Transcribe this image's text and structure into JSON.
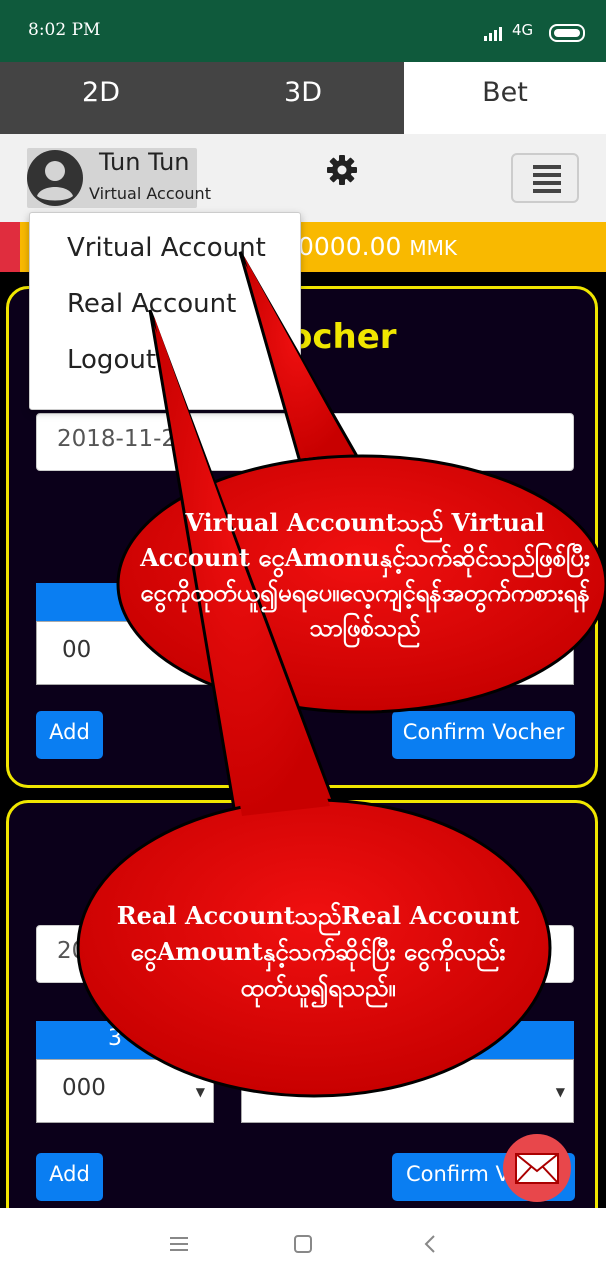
{
  "status_bar": {
    "time": "8:02 PM",
    "network": "4G"
  },
  "tabs": [
    {
      "label": "2D",
      "active": false
    },
    {
      "label": "3D",
      "active": false
    },
    {
      "label": "Bet",
      "active": true
    }
  ],
  "header": {
    "user_name": "Tun Tun",
    "account_type": "Virtual Account",
    "icons": [
      "user-avatar-icon",
      "gear-icon",
      "hamburger-menu-icon"
    ]
  },
  "balance": {
    "amount": "0000.00",
    "currency": "MMK"
  },
  "dropdown": {
    "items": [
      "Vritual Account",
      "Real Account",
      "Logout"
    ]
  },
  "panel1": {
    "title": "ocher",
    "date": "2018-11-2",
    "number_value": "00",
    "add_label": "Add",
    "confirm_label": "Confirm Vocher"
  },
  "panel2": {
    "date": "20",
    "column_label": "3",
    "number_value": "000",
    "add_label": "Add",
    "confirm_label": "Confirm V"
  },
  "callouts": [
    {
      "text": "Virtual Accountသည် Virtual Account ငွေAmonuနှင့်သက်ဆိုင်သည်ဖြစ်ပြီး ငွေကိုထုတ်ယူ၍မရပေ။လေ့ကျင့်ရန်အတွက်ကစားရန်သာဖြစ်သည်"
    },
    {
      "text": "Real Accountသည်Real Account ငွေAmountနှင့်သက်ဆိုင်ပြီး ငွေကိုလည်းထုတ်ယူ၍ရသည်။"
    }
  ],
  "colors": {
    "status_bar": "#0f5a3c",
    "tab_bar": "#444444",
    "accent_blue": "#0a7ef2",
    "panel_border": "#f0e600",
    "balance_bar": "#f9b900",
    "callout_red": "#e00000"
  },
  "nav_bar_icons": [
    "menu-icon",
    "home-square-icon",
    "back-icon"
  ]
}
